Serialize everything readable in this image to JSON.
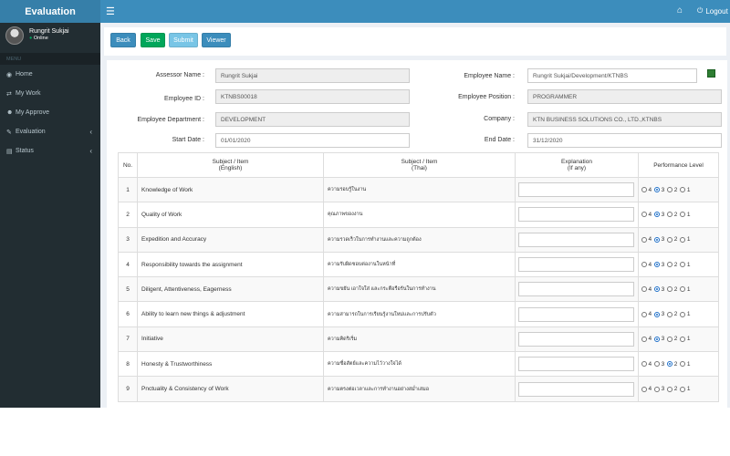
{
  "app": {
    "brand": "Evaluation"
  },
  "topbar": {
    "logout_label": "Logout"
  },
  "user": {
    "name": "Rungrit Sukjai",
    "status": "Online"
  },
  "sidebar": {
    "header": "MENU",
    "items": [
      {
        "label": "Home",
        "icon": "dashboard-icon"
      },
      {
        "label": "My Work",
        "icon": "exchange-icon"
      },
      {
        "label": "My Approve",
        "icon": "user-icon"
      },
      {
        "label": "Evaluation",
        "icon": "edit-icon"
      },
      {
        "label": "Status",
        "icon": "server-icon"
      }
    ]
  },
  "toolbar": {
    "back": "Back",
    "save": "Save",
    "submit": "Submit",
    "viewer": "Viewer",
    "colors": {
      "back": "#3c8dbc",
      "save": "#00a65a",
      "submit": "#78c5e6",
      "viewer": "#3c8dbc"
    }
  },
  "form": {
    "assessor_name_label": "Assessor Name :",
    "assessor_name": "Rungrit Sukjai",
    "employee_id_label": "Employee ID :",
    "employee_id": "KTNBS00018",
    "employee_department_label": "Employee Department :",
    "employee_department": "DEVELOPMENT",
    "start_date_label": "Start Date :",
    "start_date": "01/01/2020",
    "employee_name_label": "Employee Name :",
    "employee_name": "Rungrit Sukjai/Development/KTNBS",
    "employee_position_label": "Employee Position :",
    "employee_position": "PROGRAMMER",
    "company_label": "Company :",
    "company": "KTN BUSINESS SOLUTIONS CO., LTD.,KTNBS",
    "end_date_label": "End Date :",
    "end_date": "31/12/2020"
  },
  "table": {
    "headers": {
      "no": "No.",
      "subject_en_1": "Subject / Item",
      "subject_en_2": "(English)",
      "subject_th_1": "Subject / Item",
      "subject_th_2": "(Thai)",
      "expl_1": "Explanation",
      "expl_2": "(If any)",
      "perf": "Performance Level"
    },
    "levels": [
      "4",
      "3",
      "2",
      "1"
    ],
    "rows": [
      {
        "no": "1",
        "en": "Knowledge of Work",
        "th": "ความรอบรู้ในงาน",
        "selected": "3"
      },
      {
        "no": "2",
        "en": "Quality of Work",
        "th": "คุณภาพของงาน",
        "selected": "3"
      },
      {
        "no": "3",
        "en": "Expedition and Accuracy",
        "th": "ความรวดเร็วในการทำงานและความถูกต้อง",
        "selected": "3"
      },
      {
        "no": "4",
        "en": "Responsibility towards the assignment",
        "th": "ความรับผิดชอบต่องานในหน้าที่",
        "selected": "3"
      },
      {
        "no": "5",
        "en": "Diligent, Attentiveness, Eagerness",
        "th": "ความขยัน เอาใจใส่ และกระตือรือร้นในการทำงาน",
        "selected": "3"
      },
      {
        "no": "6",
        "en": "Ability to learn new things & adjustment",
        "th": "ความสามารถในการเรียนรู้งานใหม่และการปรับตัว",
        "selected": "3"
      },
      {
        "no": "7",
        "en": "Initiative",
        "th": "ความคิดริเริ่ม",
        "selected": "3"
      },
      {
        "no": "8",
        "en": "Honesty & Trustworthiness",
        "th": "ความซื่อสัตย์และความไว้วางใจได้",
        "selected": "2"
      },
      {
        "no": "9",
        "en": "Pnctuality & Consistency of Work",
        "th": "ความตรงต่อเวลาและการทำงานอย่างสม่ำเสมอ",
        "selected": ""
      }
    ]
  }
}
